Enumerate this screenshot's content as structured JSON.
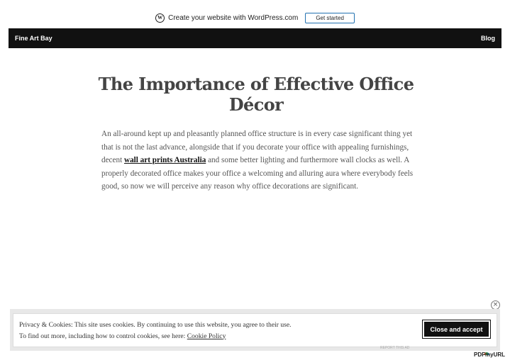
{
  "wp_bar": {
    "logo_text": "W",
    "text": "Create your website with WordPress.com",
    "button_label": "Get started"
  },
  "nav": {
    "site_title": "Fine Art Bay",
    "blog_link": "Blog"
  },
  "article": {
    "title": "The Importance of Effective Office Décor",
    "para_before_link": "An all-around kept up and pleasantly planned office structure is in every case significant thing yet that is not the last advance, alongside that if you decorate your office with appealing furnishings, decent ",
    "link_text": "wall art prints Australia",
    "para_after_link": " and some better lighting and furthermore wall clocks as well. A properly decorated office makes your office a welcoming and alluring aura where everybody feels good, so now we will perceive any reason why office decorations are significant."
  },
  "ad": {
    "close_symbol": "×"
  },
  "cookie_banner": {
    "line1": "Privacy & Cookies: This site uses cookies. By continuing to use this website, you agree to their use.",
    "line2_prefix": "To find out more, including how to control cookies, see here: ",
    "policy_link": "Cookie Policy",
    "accept_button": "Close and accept"
  },
  "footer": {
    "small_text": "REPORT THIS AD",
    "badge_text": "PDFmyURL"
  },
  "colors": {
    "nav_bg": "#111111",
    "ad_accent": "#d2458f",
    "wp_button_border": "#2271b1"
  }
}
